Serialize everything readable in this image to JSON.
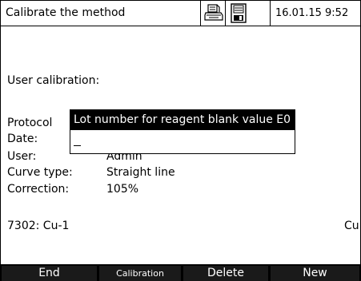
{
  "header": {
    "title": "Calibrate the method",
    "datetime": "16.01.15  9:52",
    "icons": [
      "printer-icon",
      "save-icon"
    ]
  },
  "main": {
    "section_title": "User calibration:",
    "protocol_label": "Protocol",
    "fields": [
      {
        "label": "Date:",
        "value": ""
      },
      {
        "label": "User:",
        "value": "Admin"
      },
      {
        "label": "Curve type:",
        "value": "Straight line"
      },
      {
        "label": "Correction:",
        "value": "105%"
      }
    ],
    "method": "7302: Cu-1",
    "method_suffix": "Cu"
  },
  "dialog": {
    "title": "Lot number for reagent blank value E0",
    "input_value": ""
  },
  "softkeys": {
    "end": "End",
    "calibration": "Calibration",
    "delete": "Delete",
    "new": "New"
  }
}
